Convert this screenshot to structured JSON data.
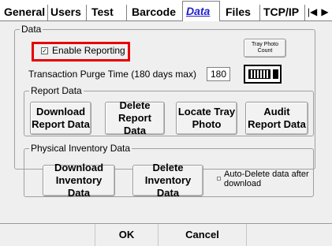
{
  "tabs": [
    {
      "label": "General",
      "active": false
    },
    {
      "label": "Users",
      "active": false
    },
    {
      "label": "Test",
      "active": false
    },
    {
      "label": "Barcode",
      "active": false
    },
    {
      "label": "Data",
      "active": true
    },
    {
      "label": "Files",
      "active": false
    },
    {
      "label": "TCP/IP",
      "active": false
    }
  ],
  "tab_scroll": {
    "left": "◀",
    "right": "▶",
    "left_bar": "|"
  },
  "data_group": {
    "legend": "Data",
    "enable_reporting": {
      "label": "Enable Reporting",
      "checked": true,
      "check_glyph": "☑"
    },
    "tray_photo_count_button": "Tray Photo Count",
    "purge_label": "Transaction Purge Time (180 days max)",
    "purge_value": "180",
    "keyboard_icon": "keyboard-icon"
  },
  "report_group": {
    "legend": "Report Data",
    "buttons": [
      "Download Report Data",
      "Delete Report Data",
      "Locate Tray Photo",
      "Audit Report Data"
    ]
  },
  "inventory_group": {
    "legend": "Physical Inventory Data",
    "download_button": "Download Inventory Data",
    "delete_button": "Delete Inventory Data",
    "auto_delete_label": "Auto-Delete data after download",
    "auto_delete_checked": false
  },
  "footer": {
    "ok_label": "OK",
    "cancel_label": "Cancel"
  },
  "colors": {
    "active_tab_text": "#1f1fd0",
    "highlight": "#e60000",
    "panel_bg": "#efefef"
  }
}
